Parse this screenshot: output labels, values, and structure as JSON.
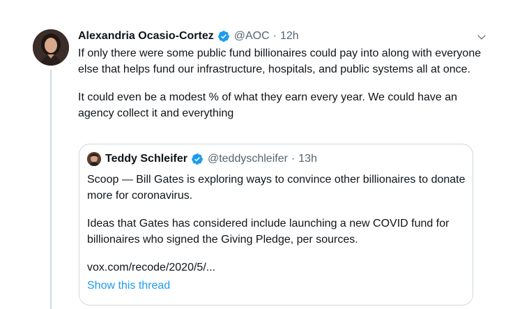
{
  "tweet": {
    "author_name": "Alexandria Ocasio-Cortez",
    "handle": "@AOC",
    "separator": "·",
    "time": "12h",
    "verified_icon": "verified-badge-icon",
    "menu_icon": "chevron-down-icon",
    "paragraphs": [
      "If only there were some public fund billionaires could pay into along with everyone else that helps fund our infrastructure, hospitals, and public systems all at once.",
      "It could even be a modest % of what they earn every year. We could have an agency collect it and everything"
    ]
  },
  "quoted_tweet": {
    "author_name": "Teddy Schleifer",
    "handle": "@teddyschleifer",
    "separator": "·",
    "time": "13h",
    "paragraphs": [
      "Scoop — Bill Gates is exploring ways to convince other billionaires to donate more for coronavirus.",
      "Ideas that Gates has considered include launching a new COVID fund for billionaires who signed the Giving Pledge, per sources."
    ],
    "link": "vox.com/recode/2020/5/...",
    "show_thread": "Show this thread"
  },
  "colors": {
    "link_blue": "#1d9bf0",
    "muted": "#536471",
    "border": "#cfd9de",
    "text": "#0f1419"
  }
}
